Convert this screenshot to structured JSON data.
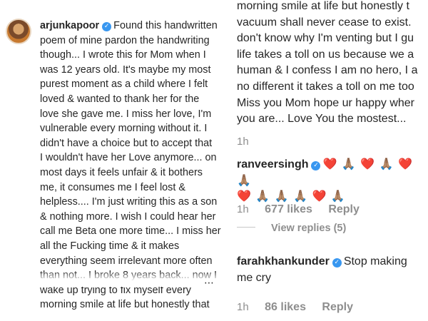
{
  "post": {
    "username": "arjunkapoor",
    "caption_lines": [
      "Found this handwritten",
      "poem of mine pardon the handwriting",
      "though... I wrote this for Mom when I",
      "was 12 years old. It's maybe my most",
      "purest moment as a child where I felt",
      "loved & wanted to thank her for the",
      "love she gave me. I miss her love, I'm",
      "vulnerable every morning without it. I",
      "didn't have a choice but to accept that",
      "I wouldn't have her Love anymore... on",
      "most days it feels unfair & it bothers",
      "me, it consumes me I feel lost &",
      "helpless.... I'm just writing this as a son",
      "& nothing more. I wish I could hear her",
      "call me Beta one more time... I miss her",
      "all the Fucking time & it makes",
      "everything seem irrelevant more often",
      "than not... I broke 8 years back... now I",
      "wake up trying to fix myself every",
      "morning smile at life but honestly that"
    ]
  },
  "continuation": {
    "lines": [
      "morning smile at life but honestly t",
      "vacuum shall never cease to exist.",
      "don't know why I'm venting but I gu",
      "life takes a toll on us because we a",
      "human & I confess I am no hero, I a",
      "no different it takes a toll on me too",
      "Miss you Mom hope ur happy wher",
      "you are... Love You the mostest..."
    ],
    "time": "1h"
  },
  "comments": [
    {
      "username": "ranveersingh",
      "emoji_line1": "❤️ 🙏🏽 ❤️ 🙏🏽 ❤️ 🙏🏽",
      "emoji_line2": "❤️ 🙏🏽 🙏🏽 🙏🏽 ❤️ 🙏🏽",
      "time": "1h",
      "likes": "677 likes",
      "reply": "Reply",
      "view_replies": "View replies (5)"
    },
    {
      "username": "farahkhankunder",
      "text_line1": "Stop making",
      "text_line2": "me cry",
      "time": "1h",
      "likes": "86 likes",
      "reply": "Reply"
    }
  ]
}
